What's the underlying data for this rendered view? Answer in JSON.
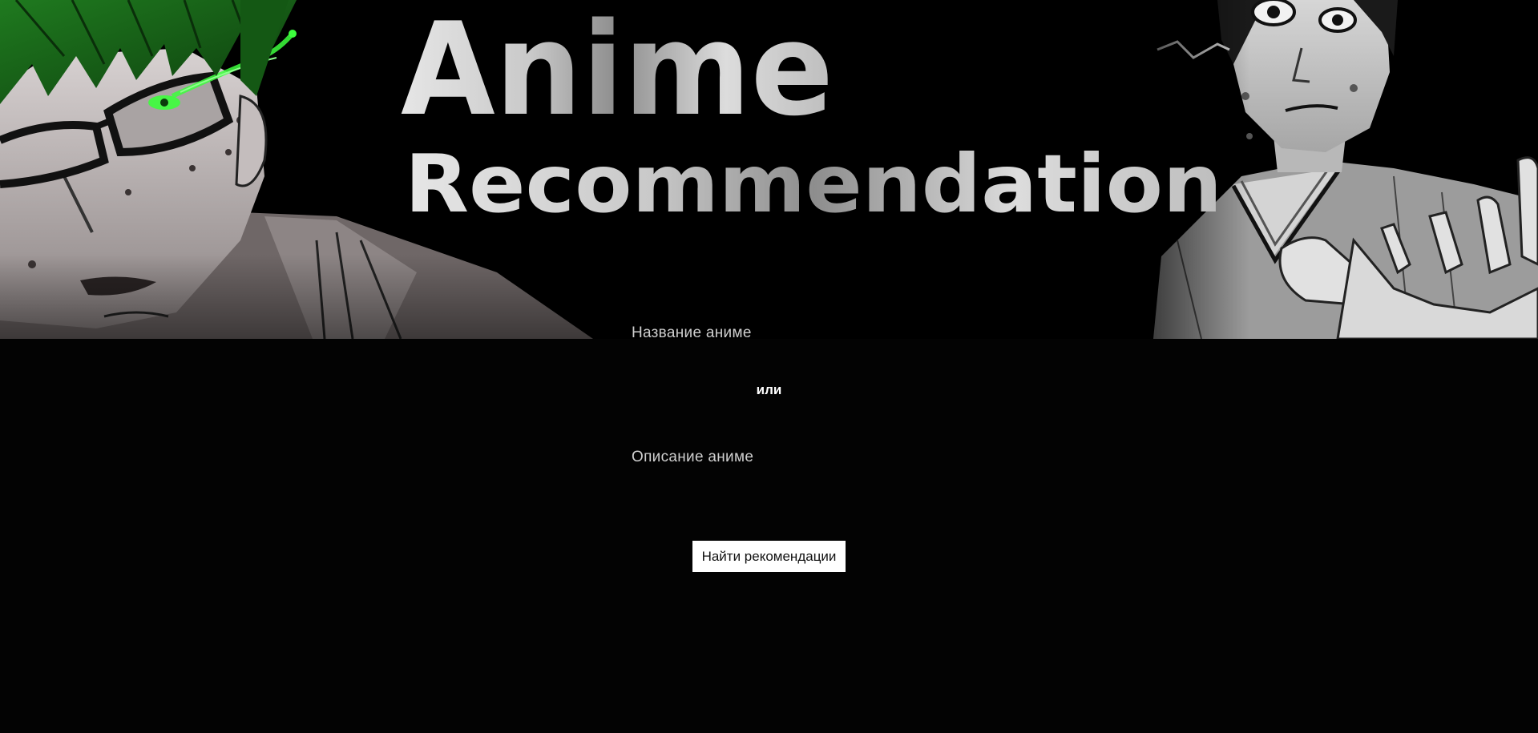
{
  "banner": {
    "title_line1": "Anime",
    "title_line2": "Recommendation"
  },
  "form": {
    "name_placeholder": "Название аниме",
    "separator": "или",
    "description_placeholder": "Описание аниме",
    "submit_label": "Найти рекомендации"
  },
  "colors": {
    "background": "#030303",
    "accent_green": "#2bd02b",
    "button_bg": "#ffffff",
    "label_text": "#cfcfcf"
  }
}
